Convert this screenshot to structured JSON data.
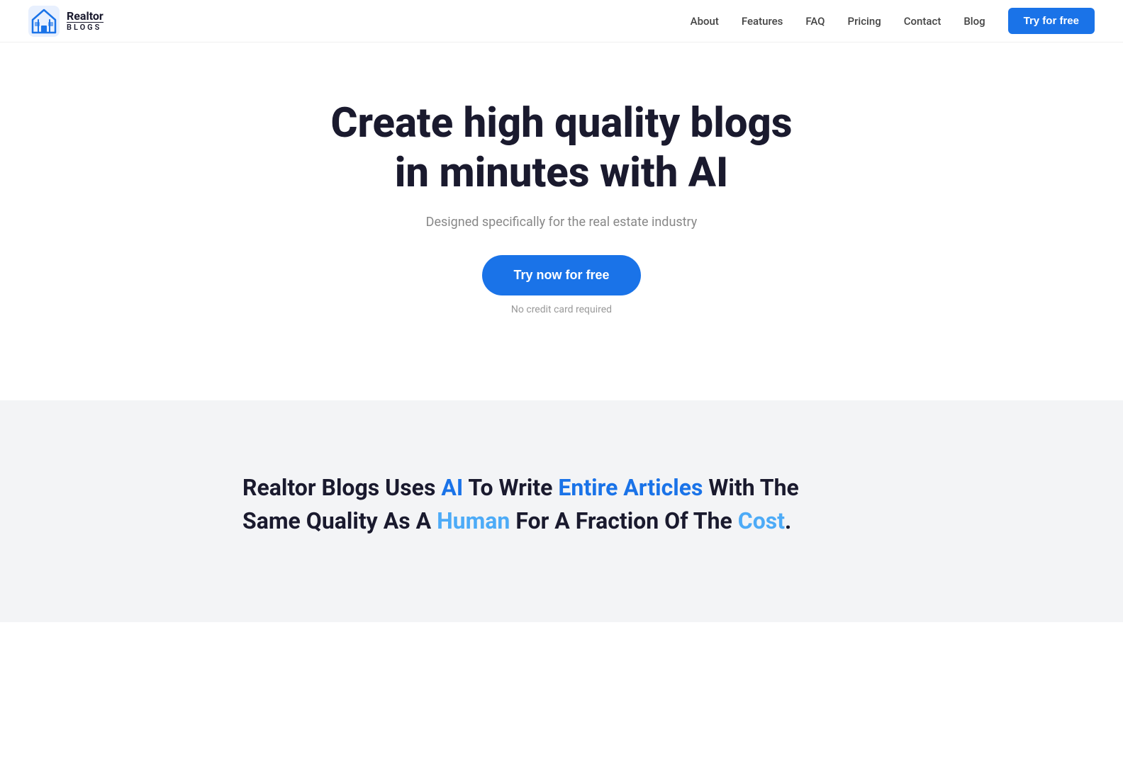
{
  "brand": {
    "name_realtor": "Realtor",
    "name_blogs": "BLOGS",
    "logo_alt": "Realtor Blogs Logo"
  },
  "nav": {
    "links": [
      {
        "label": "About",
        "id": "about"
      },
      {
        "label": "Features",
        "id": "features"
      },
      {
        "label": "FAQ",
        "id": "faq"
      },
      {
        "label": "Pricing",
        "id": "pricing"
      },
      {
        "label": "Contact",
        "id": "contact"
      },
      {
        "label": "Blog",
        "id": "blog"
      }
    ],
    "cta_label": "Try for free"
  },
  "hero": {
    "title": "Create high quality blogs in minutes with AI",
    "subtitle": "Designed specifically for the real estate industry",
    "cta_label": "Try now for free",
    "no_cc_text": "No credit card required"
  },
  "features_section": {
    "line1_plain_start": "Realtor Blogs Uses ",
    "line1_highlight1": "AI",
    "line1_plain_mid": " To Write ",
    "line1_highlight2": "Entire Articles",
    "line1_plain_end": " With The",
    "line2_plain_start": "Same Quality As A ",
    "line2_highlight1": "Human",
    "line2_plain_mid": " For A Fraction Of The ",
    "line2_highlight2": "Cost",
    "line2_plain_end": "."
  },
  "colors": {
    "brand_blue": "#1a73e8",
    "dark": "#1a1a2e",
    "gray_text": "#888888",
    "light_bg": "#f3f4f6",
    "highlight_blue": "#1a73e8",
    "highlight_light": "#4dabf7"
  }
}
